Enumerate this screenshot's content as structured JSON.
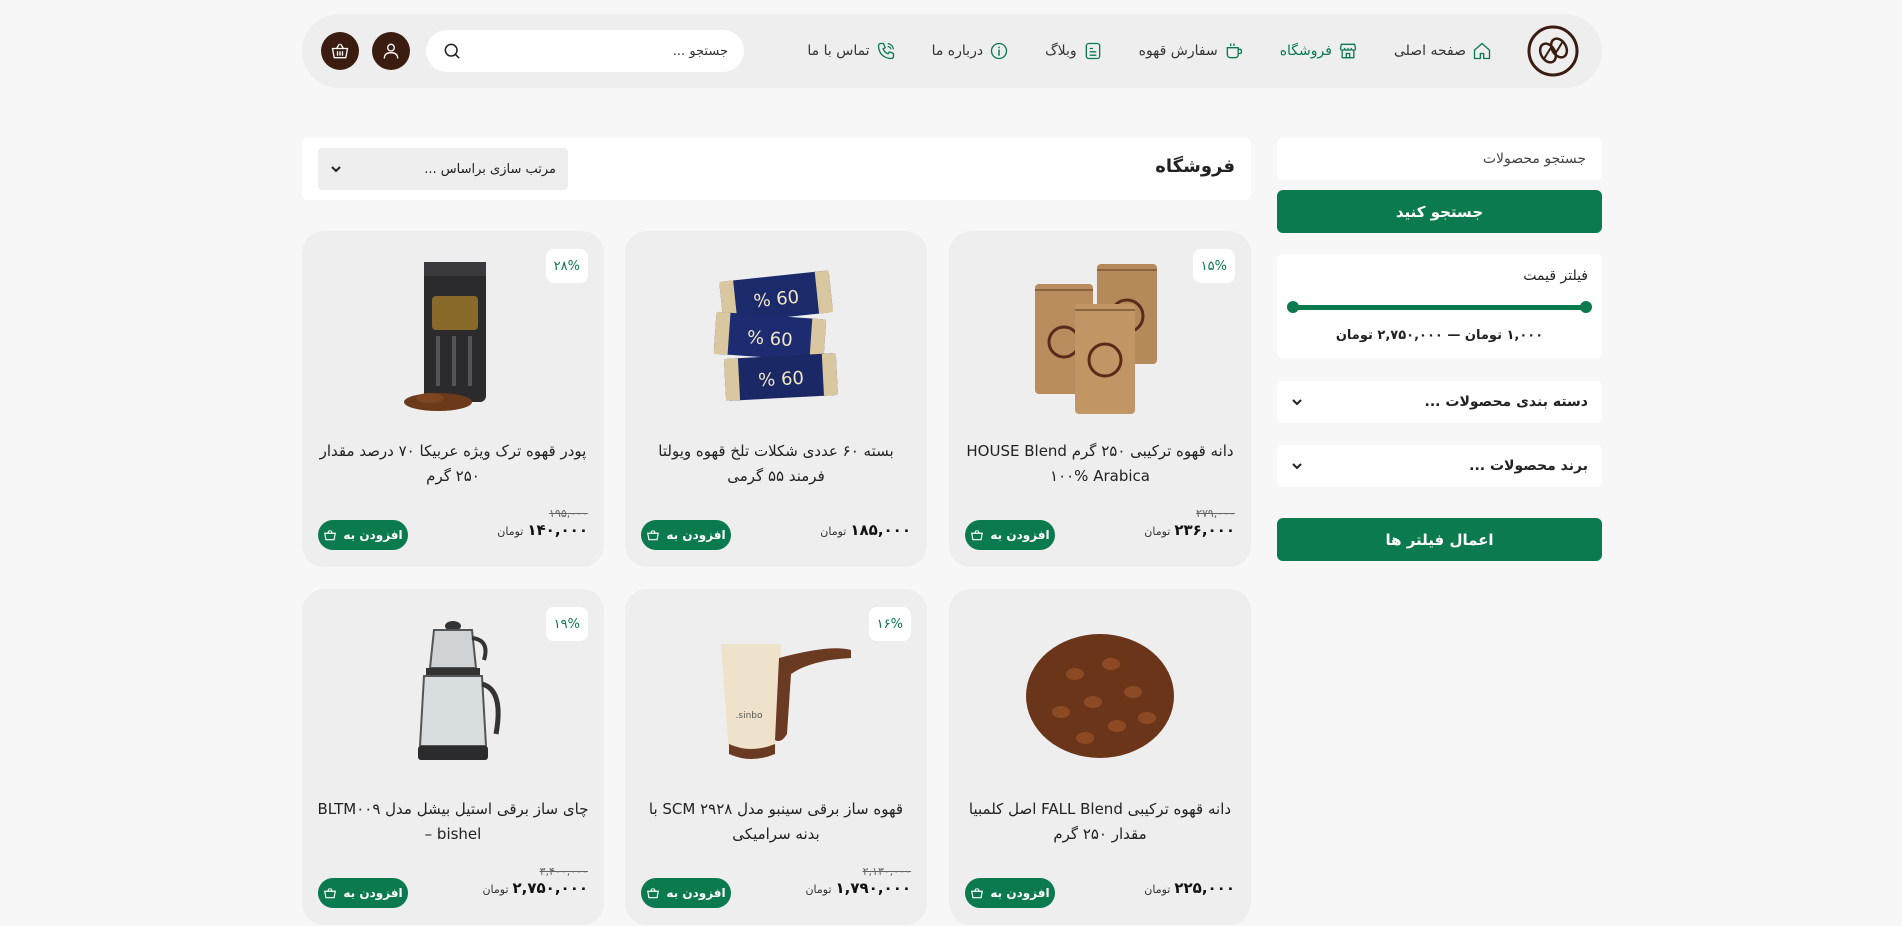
{
  "header": {
    "nav": [
      {
        "label": "صفحه اصلی",
        "icon": "home-icon"
      },
      {
        "label": "فروشگاه",
        "icon": "store-icon",
        "active": true
      },
      {
        "label": "سفارش قهوه",
        "icon": "coffee-cup-icon"
      },
      {
        "label": "وبلاگ",
        "icon": "blog-icon"
      },
      {
        "label": "درباره ما",
        "icon": "info-icon"
      },
      {
        "label": "تماس با ما",
        "icon": "phone-icon"
      }
    ],
    "search_placeholder": "جستجو ...",
    "brand_color": "#0b7a4e",
    "accent_dark": "#3a1d10"
  },
  "sidebar": {
    "search_placeholder": "جستجو محصولات",
    "search_button": "جستجو کنید",
    "price_filter_title": "فیلتر قیمت",
    "price_range": "۱,۰۰۰ تومان — ۲,۷۵۰,۰۰۰ تومان",
    "category_dropdown": "دسته بندی محصولات ...",
    "brand_dropdown": "برند محصولات ...",
    "apply_button": "اعمال فیلتر ها"
  },
  "main": {
    "title": "فروشگاه",
    "sort_label": "مرتب سازی براساس ...",
    "add_label": "افزودن به",
    "currency": "تومان",
    "products": [
      {
        "title": "دانه قهوه ترکیبی ۲۵۰ گرم HOUSE Blend ۱۰۰% Arabica",
        "badge": "۱۵%",
        "old_price": "۲۷۹,۰۰۰",
        "price": "۲۳۶,۰۰۰",
        "image": "coffee-bags"
      },
      {
        "title": "بسته ۶۰ عددی شکلات تلخ قهوه ویولتا فرمند ۵۵ گرمی",
        "badge": "",
        "old_price": "",
        "price": "۱۸۵,۰۰۰",
        "image": "chocolate"
      },
      {
        "title": "پودر قهوه ترک ویژه عربیکا ۷۰ درصد مقدار ۲۵۰ گرم",
        "badge": "۲۸%",
        "old_price": "۱۹۵,۰۰۰",
        "price": "۱۴۰,۰۰۰",
        "image": "turkish-coffee"
      },
      {
        "title": "دانه قهوه ترکیبی FALL Blend اصل کلمبیا مقدار ۲۵۰ گرم",
        "badge": "",
        "old_price": "",
        "price": "۲۲۵,۰۰۰",
        "image": "coffee-beans"
      },
      {
        "title": "قهوه ساز برقی سینبو مدل SCM ۲۹۲۸ با بدنه سرامیکی",
        "badge": "۱۶%",
        "old_price": "۲,۱۳۰,۰۰۰",
        "price": "۱,۷۹۰,۰۰۰",
        "image": "coffee-maker"
      },
      {
        "title": "چای ساز برقی استیل بیشل مدل BLTM۰۰۹ – bishel",
        "badge": "۱۹%",
        "old_price": "۳,۴۰۰,۰۰۰",
        "price": "۲,۷۵۰,۰۰۰",
        "image": "tea-maker"
      }
    ]
  }
}
